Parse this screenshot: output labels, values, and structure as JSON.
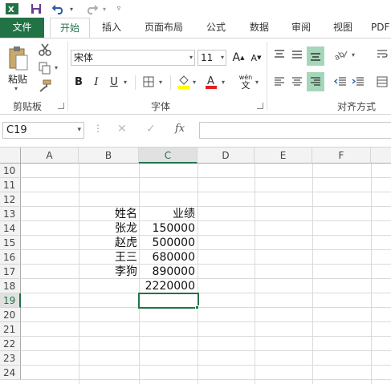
{
  "titlebar": {
    "app_icon": "excel-icon",
    "qat": [
      "save-icon",
      "undo-icon",
      "redo-icon",
      "customize-icon"
    ]
  },
  "tabs": [
    "文件",
    "开始",
    "插入",
    "页面布局",
    "公式",
    "数据",
    "审阅",
    "视图",
    "PDF"
  ],
  "ribbon": {
    "clipboard": {
      "paste_label": "粘贴",
      "group_label": "剪贴板"
    },
    "font": {
      "font_name": "宋体",
      "font_size": "11",
      "group_label": "字体",
      "bold": "B",
      "italic": "I",
      "underline": "U",
      "phonetic": "wén"
    },
    "alignment": {
      "group_label": "对齐方式"
    }
  },
  "formula_bar": {
    "name_box": "C19",
    "fx": "fx",
    "value": ""
  },
  "grid": {
    "columns": [
      "A",
      "B",
      "C",
      "D",
      "E",
      "F"
    ],
    "selected_column": "C",
    "rows": [
      "10",
      "11",
      "12",
      "13",
      "14",
      "15",
      "16",
      "17",
      "18",
      "19",
      "20",
      "21",
      "22",
      "23",
      "24"
    ],
    "selected_row": "19",
    "cells": {
      "B13": "姓名",
      "C13": "业绩",
      "B14": "张龙",
      "C14": "150000",
      "B15": "赵虎",
      "C15": "500000",
      "B16": "王三",
      "C16": "680000",
      "B17": "李狗",
      "C17": "890000",
      "C18": "2220000"
    }
  },
  "colors": {
    "accent": "#217346",
    "header_bg": "#f3f3f3",
    "gridline": "#dadada"
  }
}
